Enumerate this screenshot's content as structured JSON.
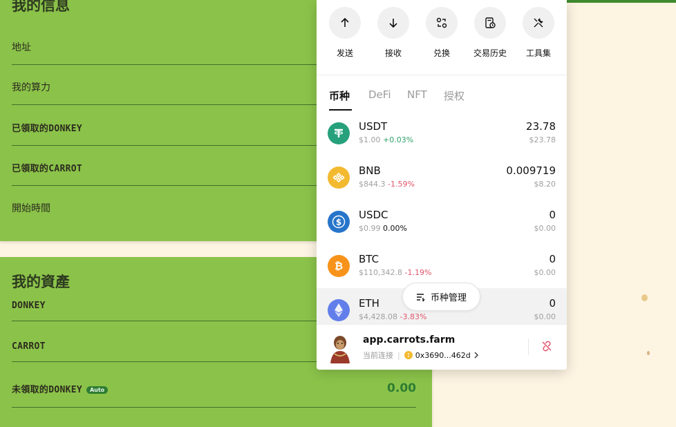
{
  "info_card": {
    "title": "我的信息",
    "rows": [
      {
        "label": "地址",
        "mono": false
      },
      {
        "label": "我的算力",
        "mono": false
      },
      {
        "label": "已領取的DONKEY",
        "mono": true
      },
      {
        "label": "已領取的CARROT",
        "mono": true
      },
      {
        "label": "開始時間",
        "mono": false
      }
    ]
  },
  "assets_card": {
    "title": "我的資產",
    "rows": [
      {
        "label": "DONKEY"
      },
      {
        "label": "CARROT"
      },
      {
        "label": "未領取的DONKEY",
        "badge": "Auto",
        "value": "0.00"
      }
    ]
  },
  "wallet": {
    "actions": [
      {
        "label": "发送",
        "icon": "arrow-up-icon"
      },
      {
        "label": "接收",
        "icon": "arrow-down-icon"
      },
      {
        "label": "兑换",
        "icon": "swap-icon"
      },
      {
        "label": "交易历史",
        "icon": "history-icon"
      },
      {
        "label": "工具集",
        "icon": "tools-icon"
      }
    ],
    "tabs": [
      "币种",
      "DeFi",
      "NFT",
      "授权"
    ],
    "active_tab": "币种",
    "coins": [
      {
        "symbol": "USDT",
        "price": "$1.00",
        "change": "+0.03%",
        "trend": "pos",
        "amount": "23.78",
        "usd": "$23.78",
        "color": "#26a17b"
      },
      {
        "symbol": "BNB",
        "price": "$844.3",
        "change": "-1.59%",
        "trend": "neg",
        "amount": "0.009719",
        "usd": "$8.20",
        "color": "#f3ba2f"
      },
      {
        "symbol": "USDC",
        "price": "$0.99",
        "change": "0.00%",
        "trend": "neu",
        "amount": "0",
        "usd": "$0.00",
        "color": "#2775ca"
      },
      {
        "symbol": "BTC",
        "price": "$110,342.8",
        "change": "-1.19%",
        "trend": "neg",
        "amount": "0",
        "usd": "$0.00",
        "color": "#f7931a"
      },
      {
        "symbol": "ETH",
        "price": "$4,428.08",
        "change": "-3.83%",
        "trend": "neg",
        "amount": "0",
        "usd": "$0.00",
        "color": "#627eea"
      }
    ],
    "manage_label": "币种管理",
    "footer": {
      "site": "app.carrots.farm",
      "status": "当前连接",
      "address": "0x3690...462d"
    }
  }
}
